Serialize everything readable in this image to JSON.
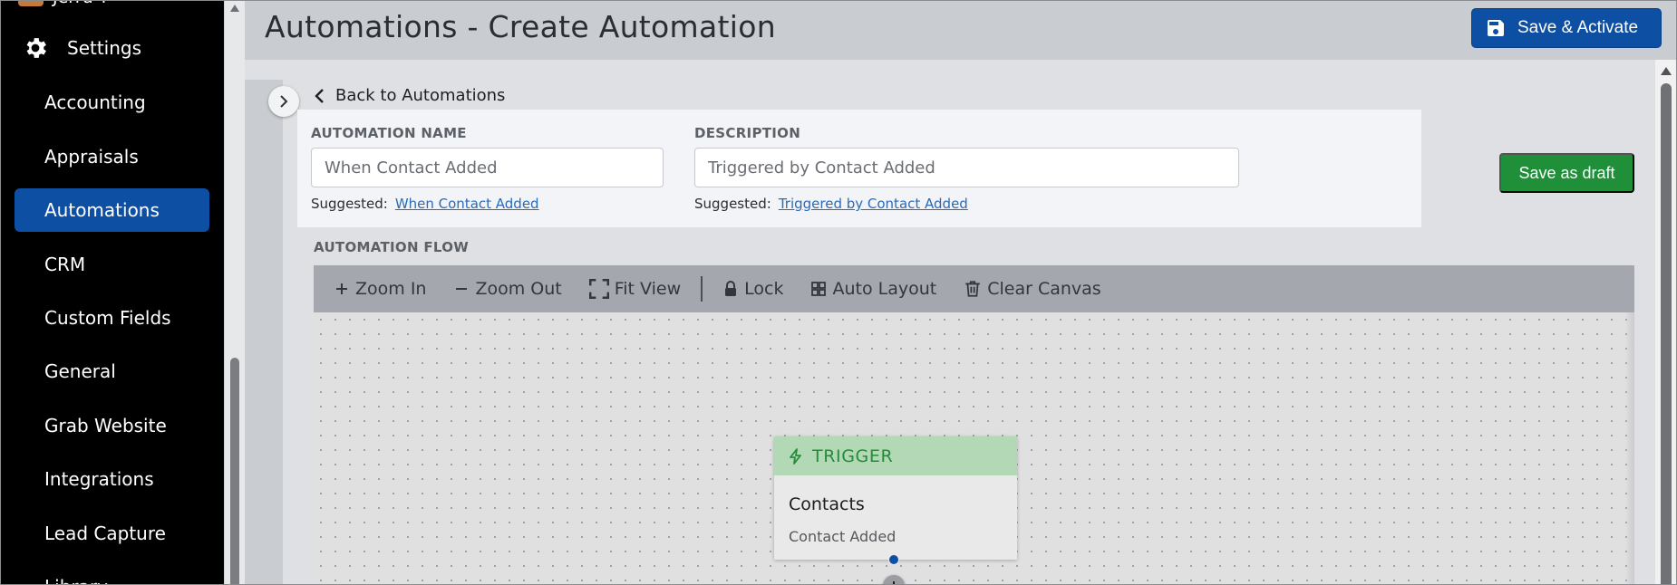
{
  "sidebar": {
    "cut_top_label": "Jerru T",
    "settings_label": "Settings",
    "items": [
      {
        "label": "Accounting"
      },
      {
        "label": "Appraisals"
      },
      {
        "label": "Automations",
        "active": true
      },
      {
        "label": "CRM"
      },
      {
        "label": "Custom Fields"
      },
      {
        "label": "General"
      },
      {
        "label": "Grab Website"
      },
      {
        "label": "Integrations"
      },
      {
        "label": "Lead Capture"
      },
      {
        "label": "Library"
      }
    ]
  },
  "header": {
    "title": "Automations - Create Automation",
    "save_activate_label": "Save & Activate"
  },
  "main": {
    "back_label": "Back to Automations",
    "name_field": {
      "label": "AUTOMATION NAME",
      "value": "When Contact Added",
      "suggested_prefix": "Suggested:",
      "suggested_value": "When Contact Added"
    },
    "description_field": {
      "label": "DESCRIPTION",
      "value": "Triggered by Contact Added",
      "suggested_prefix": "Suggested:",
      "suggested_value": "Triggered by Contact Added"
    },
    "save_draft_label": "Save as draft",
    "flow_label": "AUTOMATION FLOW",
    "toolbar": {
      "zoom_in": "Zoom In",
      "zoom_out": "Zoom Out",
      "fit_view": "Fit View",
      "lock": "Lock",
      "auto_layout": "Auto Layout",
      "clear_canvas": "Clear Canvas"
    },
    "trigger_node": {
      "header": "TRIGGER",
      "title": "Contacts",
      "subtitle": "Contact Added"
    }
  },
  "colors": {
    "sidebar_bg": "#000000",
    "active_nav": "#0d4fa3",
    "primary_button": "#0d4fa3",
    "draft_button": "#1f8f3a",
    "trigger_header_bg": "#b2d8b5",
    "trigger_text": "#248c3a"
  },
  "icons": {
    "settings": "gear-icon",
    "save": "floppy-disk-icon",
    "back": "chevron-left-icon",
    "expand": "chevron-right-icon",
    "zoom_in": "plus-icon",
    "zoom_out": "minus-icon",
    "fit_view": "fit-view-icon",
    "lock": "lock-icon",
    "auto_layout": "grid-icon",
    "clear_canvas": "trash-icon",
    "trigger": "lightning-bolt-icon",
    "add_node": "plus-icon"
  }
}
